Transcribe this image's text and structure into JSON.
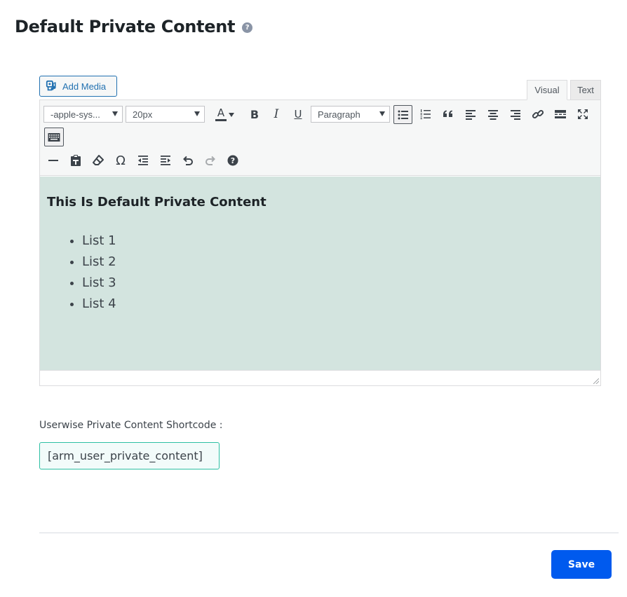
{
  "page": {
    "title": "Default Private Content",
    "help_icon": "question-circle-icon"
  },
  "editor": {
    "add_media_label": "Add Media",
    "tabs": {
      "visual": "Visual",
      "text": "Text",
      "active": "visual"
    },
    "toolbar": {
      "font_family": "-apple-sys...",
      "font_size": "20px",
      "format": "Paragraph",
      "text_color_label": "A",
      "bold_label": "B",
      "italic_label": "I",
      "underline_label": "U",
      "row1_icons": [
        "bullet-list-icon",
        "numbered-list-icon",
        "blockquote-icon",
        "align-left-icon",
        "align-center-icon",
        "align-right-icon",
        "link-icon",
        "read-more-icon",
        "fullscreen-icon",
        "keyboard-toggle-icon"
      ],
      "row2_icons": [
        "horizontal-line-icon",
        "paste-as-text-icon",
        "clear-formatting-icon",
        "special-character-icon",
        "outdent-icon",
        "indent-icon",
        "undo-icon",
        "redo-icon",
        "help-icon"
      ]
    },
    "content": {
      "heading": "This Is Default Private Content",
      "list": [
        "List 1",
        "List 2",
        "List 3",
        "List 4"
      ],
      "background": "#d3e4df"
    }
  },
  "shortcode": {
    "label": "Userwise Private Content Shortcode :",
    "value": "[arm_user_private_content]"
  },
  "actions": {
    "save_label": "Save",
    "save_color": "#005aee"
  }
}
